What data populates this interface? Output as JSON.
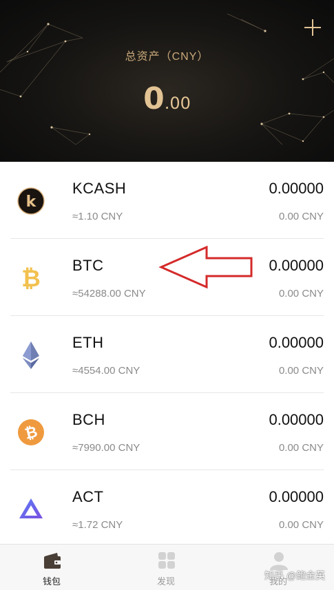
{
  "header": {
    "total_label": "总资产（CNY）",
    "total_int": "0",
    "total_dec": ".00",
    "add_icon": "plus-icon",
    "accent": "#e2c394"
  },
  "assets": [
    {
      "symbol": "KCASH",
      "price": "≈1.10 CNY",
      "amount": "0.00000",
      "value": "0.00 CNY",
      "icon": "kcash-logo-icon"
    },
    {
      "symbol": "BTC",
      "price": "≈54288.00 CNY",
      "amount": "0.00000",
      "value": "0.00 CNY",
      "icon": "bitcoin-icon"
    },
    {
      "symbol": "ETH",
      "price": "≈4554.00 CNY",
      "amount": "0.00000",
      "value": "0.00 CNY",
      "icon": "ethereum-icon"
    },
    {
      "symbol": "BCH",
      "price": "≈7990.00 CNY",
      "amount": "0.00000",
      "value": "0.00 CNY",
      "icon": "bitcoin-cash-icon"
    },
    {
      "symbol": "ACT",
      "price": "≈1.72 CNY",
      "amount": "0.00000",
      "value": "0.00 CNY",
      "icon": "achain-icon"
    }
  ],
  "annotation": {
    "arrow_color": "#d42a2a"
  },
  "tabs": [
    {
      "label": "钱包",
      "icon": "wallet-icon",
      "active": true
    },
    {
      "label": "发现",
      "icon": "grid-icon",
      "active": false
    },
    {
      "label": "我的",
      "icon": "profile-icon",
      "active": false
    }
  ],
  "watermark": "知乎 @鲍金英"
}
